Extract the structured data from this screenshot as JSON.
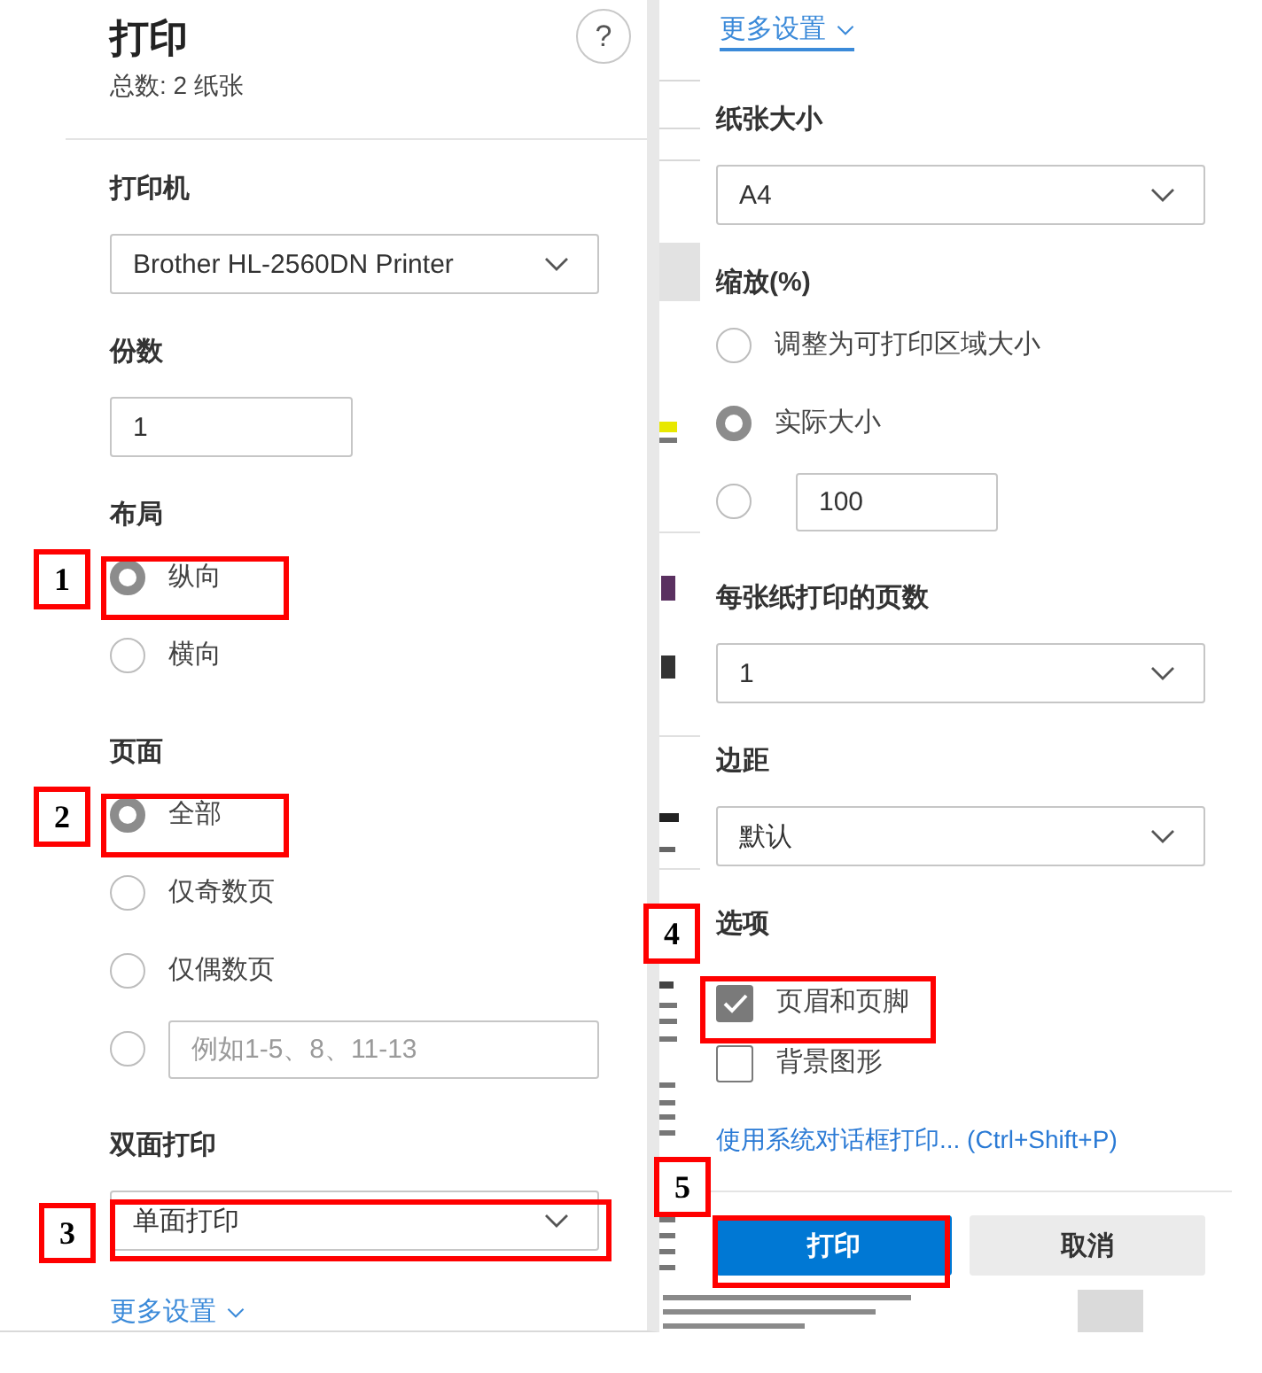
{
  "print_panel": {
    "title": "打印",
    "help_button": "?",
    "summary": "总数: 2 纸张",
    "sections": [
      {
        "kind": "select",
        "label": "打印机",
        "value": "Brother HL-2560DN Printer"
      },
      {
        "kind": "input",
        "label": "份数",
        "value": "1"
      },
      {
        "kind": "radio",
        "label": "布局",
        "options": [
          {
            "kind": "text",
            "label": "纵向",
            "selected": true,
            "annotation": "1"
          },
          {
            "kind": "text",
            "label": "横向",
            "selected": false
          }
        ]
      },
      {
        "kind": "radio",
        "label": "页面",
        "options": [
          {
            "kind": "text",
            "label": "全部",
            "selected": true,
            "annotation": "2"
          },
          {
            "kind": "text",
            "label": "仅奇数页",
            "selected": false
          },
          {
            "kind": "text",
            "label": "仅偶数页",
            "selected": false
          },
          {
            "kind": "field",
            "placeholder": "例如1-5、8、11-13",
            "selected": false
          }
        ]
      },
      {
        "kind": "select",
        "label": "双面打印",
        "value": "单面打印",
        "annotation": "3"
      }
    ],
    "more_settings": {
      "label": "更多设置",
      "focused": false
    }
  },
  "more_settings_panel": {
    "more_settings": {
      "label": "更多设置",
      "focused": true
    },
    "sections": [
      {
        "kind": "select",
        "label": "纸张大小",
        "value": "A4"
      },
      {
        "kind": "radio",
        "label": "缩放(%)",
        "options": [
          {
            "kind": "text",
            "label": "调整为可打印区域大小",
            "selected": false
          },
          {
            "kind": "text",
            "label": "实际大小",
            "selected": true
          },
          {
            "kind": "field",
            "value": "100",
            "selected": false
          }
        ]
      },
      {
        "kind": "select",
        "label": "每张纸打印的页数",
        "value": "1"
      },
      {
        "kind": "select",
        "label": "边距",
        "value": "默认"
      },
      {
        "kind": "checkbox",
        "label": "选项",
        "options": [
          {
            "label": "页眉和页脚",
            "checked": true,
            "annotation": "4"
          },
          {
            "label": "背景图形",
            "checked": false
          }
        ]
      }
    ],
    "system_dialog_link": "使用系统对话框打印... (Ctrl+Shift+P)",
    "buttons": [
      {
        "kind": "primary",
        "label": "打印",
        "annotation": "5"
      },
      {
        "kind": "secondary",
        "label": "取消"
      }
    ]
  }
}
